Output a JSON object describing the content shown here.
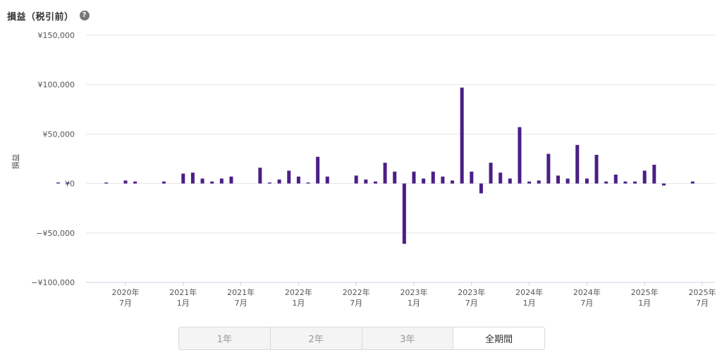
{
  "header": {
    "title": "損益（税引前）",
    "help_icon": "question-circle-icon",
    "help_glyph": "?"
  },
  "period_tabs": [
    {
      "label": "1年",
      "active": false
    },
    {
      "label": "2年",
      "active": false
    },
    {
      "label": "3年",
      "active": false
    },
    {
      "label": "全期間",
      "active": true
    }
  ],
  "chart_data": {
    "type": "bar",
    "ylabel": "損益",
    "ylim": [
      -100000,
      150000
    ],
    "yticks": [
      {
        "value": 150000,
        "label": "¥150,000"
      },
      {
        "value": 100000,
        "label": "¥100,000"
      },
      {
        "value": 50000,
        "label": "¥50,000"
      },
      {
        "value": 0,
        "label": "¥0"
      },
      {
        "value": -50000,
        "label": "−¥50,000"
      },
      {
        "value": -100000,
        "label": "−¥100,000"
      }
    ],
    "bar_color": "#4b1f86",
    "grid": true,
    "xticks": [
      {
        "date": "2020-07",
        "year": "2020年",
        "month": "7月"
      },
      {
        "date": "2021-01",
        "year": "2021年",
        "month": "1月"
      },
      {
        "date": "2021-07",
        "year": "2021年",
        "month": "7月"
      },
      {
        "date": "2022-01",
        "year": "2022年",
        "month": "1月"
      },
      {
        "date": "2022-07",
        "year": "2022年",
        "month": "7月"
      },
      {
        "date": "2023-01",
        "year": "2023年",
        "month": "1月"
      },
      {
        "date": "2023-07",
        "year": "2023年",
        "month": "7月"
      },
      {
        "date": "2024-01",
        "year": "2024年",
        "month": "1月"
      },
      {
        "date": "2024-07",
        "year": "2024年",
        "month": "7月"
      },
      {
        "date": "2025-01",
        "year": "2025年",
        "month": "1月"
      },
      {
        "date": "2025-07",
        "year": "2025年",
        "month": "7月"
      }
    ],
    "x": [
      "2019-12",
      "2020-01",
      "2020-02",
      "2020-03",
      "2020-04",
      "2020-05",
      "2020-06",
      "2020-07",
      "2020-08",
      "2020-09",
      "2020-10",
      "2020-11",
      "2020-12",
      "2021-01",
      "2021-02",
      "2021-03",
      "2021-04",
      "2021-05",
      "2021-06",
      "2021-07",
      "2021-08",
      "2021-09",
      "2021-10",
      "2021-11",
      "2021-12",
      "2022-01",
      "2022-02",
      "2022-03",
      "2022-04",
      "2022-05",
      "2022-06",
      "2022-07",
      "2022-08",
      "2022-09",
      "2022-10",
      "2022-11",
      "2022-12",
      "2023-01",
      "2023-02",
      "2023-03",
      "2023-04",
      "2023-05",
      "2023-06",
      "2023-07",
      "2023-08",
      "2023-09",
      "2023-10",
      "2023-11",
      "2023-12",
      "2024-01",
      "2024-02",
      "2024-03",
      "2024-04",
      "2024-05",
      "2024-06",
      "2024-07",
      "2024-08",
      "2024-09",
      "2024-10",
      "2024-11",
      "2024-12",
      "2025-01",
      "2025-02",
      "2025-03",
      "2025-04",
      "2025-05",
      "2025-06",
      "2025-07"
    ],
    "values": [
      1000,
      1000,
      0,
      0,
      0,
      1000,
      0,
      3000,
      2000,
      0,
      0,
      2000,
      0,
      10000,
      11000,
      5000,
      2000,
      5000,
      7000,
      0,
      0,
      16000,
      1000,
      4000,
      13000,
      7000,
      1000,
      27000,
      7000,
      0,
      0,
      8000,
      4000,
      2000,
      21000,
      12000,
      -61000,
      12000,
      5000,
      12000,
      7000,
      3000,
      97000,
      12000,
      -10000,
      21000,
      11000,
      5000,
      57000,
      2000,
      3000,
      30000,
      8000,
      5000,
      39000,
      5000,
      29000,
      2000,
      9000,
      2000,
      2000,
      13000,
      19000,
      -2000,
      0,
      0,
      2000,
      0
    ]
  }
}
